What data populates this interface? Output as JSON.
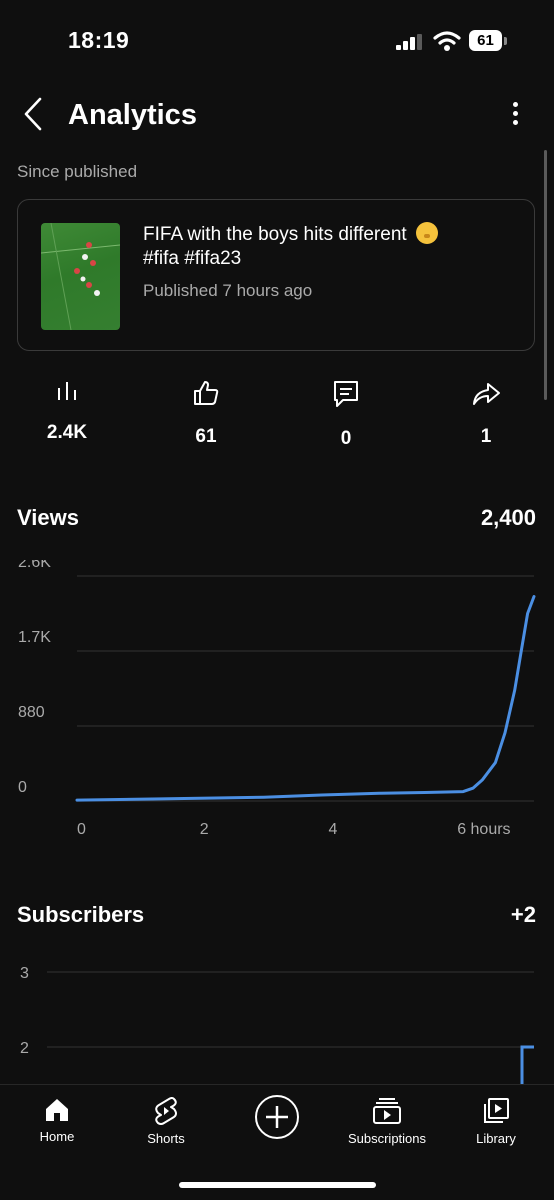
{
  "status_bar": {
    "time": "18:19",
    "battery": "61"
  },
  "header": {
    "title": "Analytics"
  },
  "since_label": "Since published",
  "video": {
    "title": "FIFA with the boys hits different",
    "hashtags": "#fifa #fifa23",
    "published": "Published 7 hours ago",
    "emoji": "shushing-face-emoji"
  },
  "stats": [
    {
      "icon": "views-bar-icon",
      "value": "2.4K"
    },
    {
      "icon": "thumbs-up-icon",
      "value": "61"
    },
    {
      "icon": "comment-icon",
      "value": "0"
    },
    {
      "icon": "share-icon",
      "value": "1"
    }
  ],
  "views": {
    "label": "Views",
    "total": "2,400"
  },
  "subscribers": {
    "label": "Subscribers",
    "total": "+2"
  },
  "chart_data": [
    {
      "type": "line",
      "title": "Views",
      "x_tick_labels": [
        "0",
        "2",
        "4",
        "6 hours"
      ],
      "x_ticks": [
        0,
        2,
        4,
        6
      ],
      "y_tick_labels": [
        "2.6K",
        "1.7K",
        "880",
        "0"
      ],
      "y_ticks": [
        2640,
        1760,
        880,
        0
      ],
      "xlim": [
        0,
        7.1
      ],
      "ylim": [
        0,
        2640
      ],
      "grid": true,
      "color": "#4b8fe3",
      "x": [
        0,
        1.3,
        2.9,
        3.8,
        4.7,
        5.4,
        6.0,
        6.15,
        6.3,
        6.5,
        6.65,
        6.8,
        6.9,
        7.0,
        7.1
      ],
      "y": [
        10,
        25,
        45,
        70,
        90,
        100,
        110,
        150,
        250,
        450,
        800,
        1300,
        1750,
        2200,
        2400
      ]
    },
    {
      "type": "line",
      "title": "Subscribers",
      "y_tick_labels": [
        "3",
        "2"
      ],
      "y_ticks": [
        3,
        2
      ],
      "grid": true,
      "color": "#4b8fe3",
      "x": [
        6.95,
        7.0,
        7.1
      ],
      "y": [
        1.5,
        2,
        2
      ]
    }
  ],
  "bottom_nav": [
    {
      "icon": "home-icon",
      "label": "Home"
    },
    {
      "icon": "shorts-icon",
      "label": "Shorts"
    },
    {
      "icon": "create-plus-icon",
      "label": ""
    },
    {
      "icon": "subscriptions-icon",
      "label": "Subscriptions"
    },
    {
      "icon": "library-icon",
      "label": "Library"
    }
  ]
}
